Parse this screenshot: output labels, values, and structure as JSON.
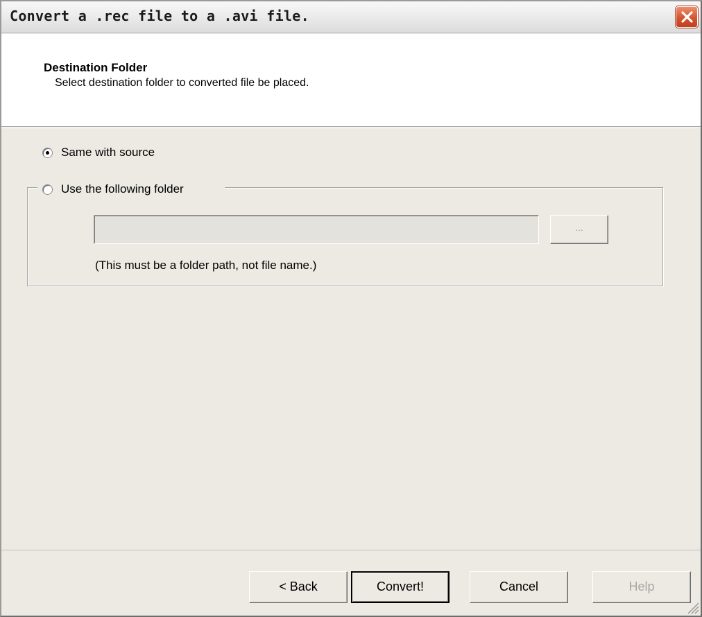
{
  "window": {
    "title": "Convert a .rec file to a .avi file.",
    "close_icon": "close-icon"
  },
  "header": {
    "title": "Destination Folder",
    "subtitle": "Select destination folder to converted file be placed."
  },
  "options": {
    "same_with_source": {
      "label": "Same with source",
      "checked": true
    },
    "use_following_folder": {
      "label": "Use the following folder",
      "checked": false
    }
  },
  "folder": {
    "path_value": "",
    "browse_label": "...",
    "hint": "(This must be a folder path, not file name.)"
  },
  "buttons": {
    "back": "< Back",
    "convert": "Convert!",
    "cancel": "Cancel",
    "help": "Help"
  }
}
